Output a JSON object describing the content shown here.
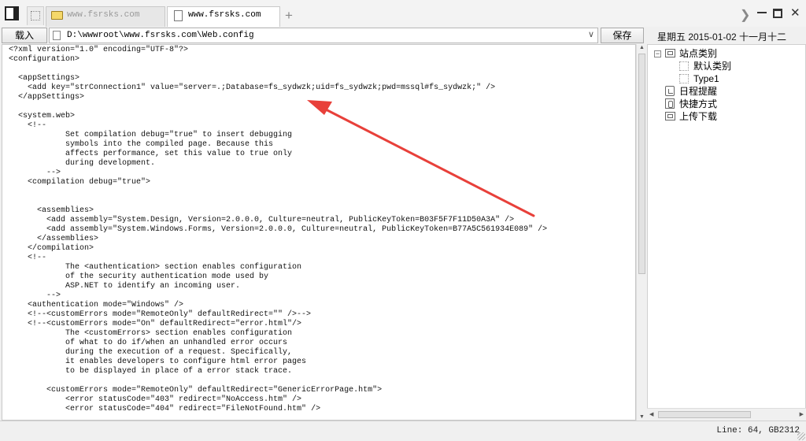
{
  "tabs": [
    {
      "label": "www.fsrsks.com",
      "active": false
    },
    {
      "label": "www.fsrsks.com",
      "active": true
    }
  ],
  "toolbar": {
    "load_label": "载入",
    "path_value": "D:\\wwwroot\\www.fsrsks.com\\Web.config",
    "save_label": "保存"
  },
  "datebar": {
    "text": "星期五 2015-01-02 十一月十二"
  },
  "editor": {
    "lines": [
      "<?xml version=\"1.0\" encoding=\"UTF-8\"?>",
      "<configuration>",
      "",
      "  <appSettings>",
      "    <add key=\"strConnection1\" value=\"server=.;Database=fs_sydwzk;uid=fs_sydwzk;pwd=mssql#fs_sydwzk;\" />",
      "  </appSettings>",
      "",
      "  <system.web>",
      "    <!--",
      "            Set compilation debug=\"true\" to insert debugging",
      "            symbols into the compiled page. Because this",
      "            affects performance, set this value to true only",
      "            during development.",
      "        -->",
      "    <compilation debug=\"true\">",
      "",
      "",
      "      <assemblies>",
      "        <add assembly=\"System.Design, Version=2.0.0.0, Culture=neutral, PublicKeyToken=B03F5F7F11D50A3A\" />",
      "        <add assembly=\"System.Windows.Forms, Version=2.0.0.0, Culture=neutral, PublicKeyToken=B77A5C561934E089\" />",
      "      </assemblies>",
      "    </compilation>",
      "    <!--",
      "            The <authentication> section enables configuration",
      "            of the security authentication mode used by",
      "            ASP.NET to identify an incoming user.",
      "        -->",
      "    <authentication mode=\"Windows\" />",
      "    <!--<customErrors mode=\"RemoteOnly\" defaultRedirect=\"\" />-->",
      "    <!--<customErrors mode=\"On\" defaultRedirect=\"error.html\"/>",
      "            The <customErrors> section enables configuration",
      "            of what to do if/when an unhandled error occurs",
      "            during the execution of a request. Specifically,",
      "            it enables developers to configure html error pages",
      "            to be displayed in place of a error stack trace.",
      "",
      "        <customErrors mode=\"RemoteOnly\" defaultRedirect=\"GenericErrorPage.htm\">",
      "            <error statusCode=\"403\" redirect=\"NoAccess.htm\" />",
      "            <error statusCode=\"404\" redirect=\"FileNotFound.htm\" />"
    ]
  },
  "tree": [
    {
      "label": "站点类别",
      "icon": "folder-icon",
      "expanded": true
    },
    {
      "label": "默认类别",
      "icon": "blank-node-icon"
    },
    {
      "label": "Type1",
      "icon": "blank-node-icon"
    },
    {
      "label": "日程提醒",
      "icon": "calendar-icon"
    },
    {
      "label": "快捷方式",
      "icon": "shortcut-icon"
    },
    {
      "label": "上传下载",
      "icon": "folder-icon"
    }
  ],
  "status": {
    "text": "Line: 64, GB2312"
  },
  "colors": {
    "annotation_arrow": "#e8403a"
  }
}
